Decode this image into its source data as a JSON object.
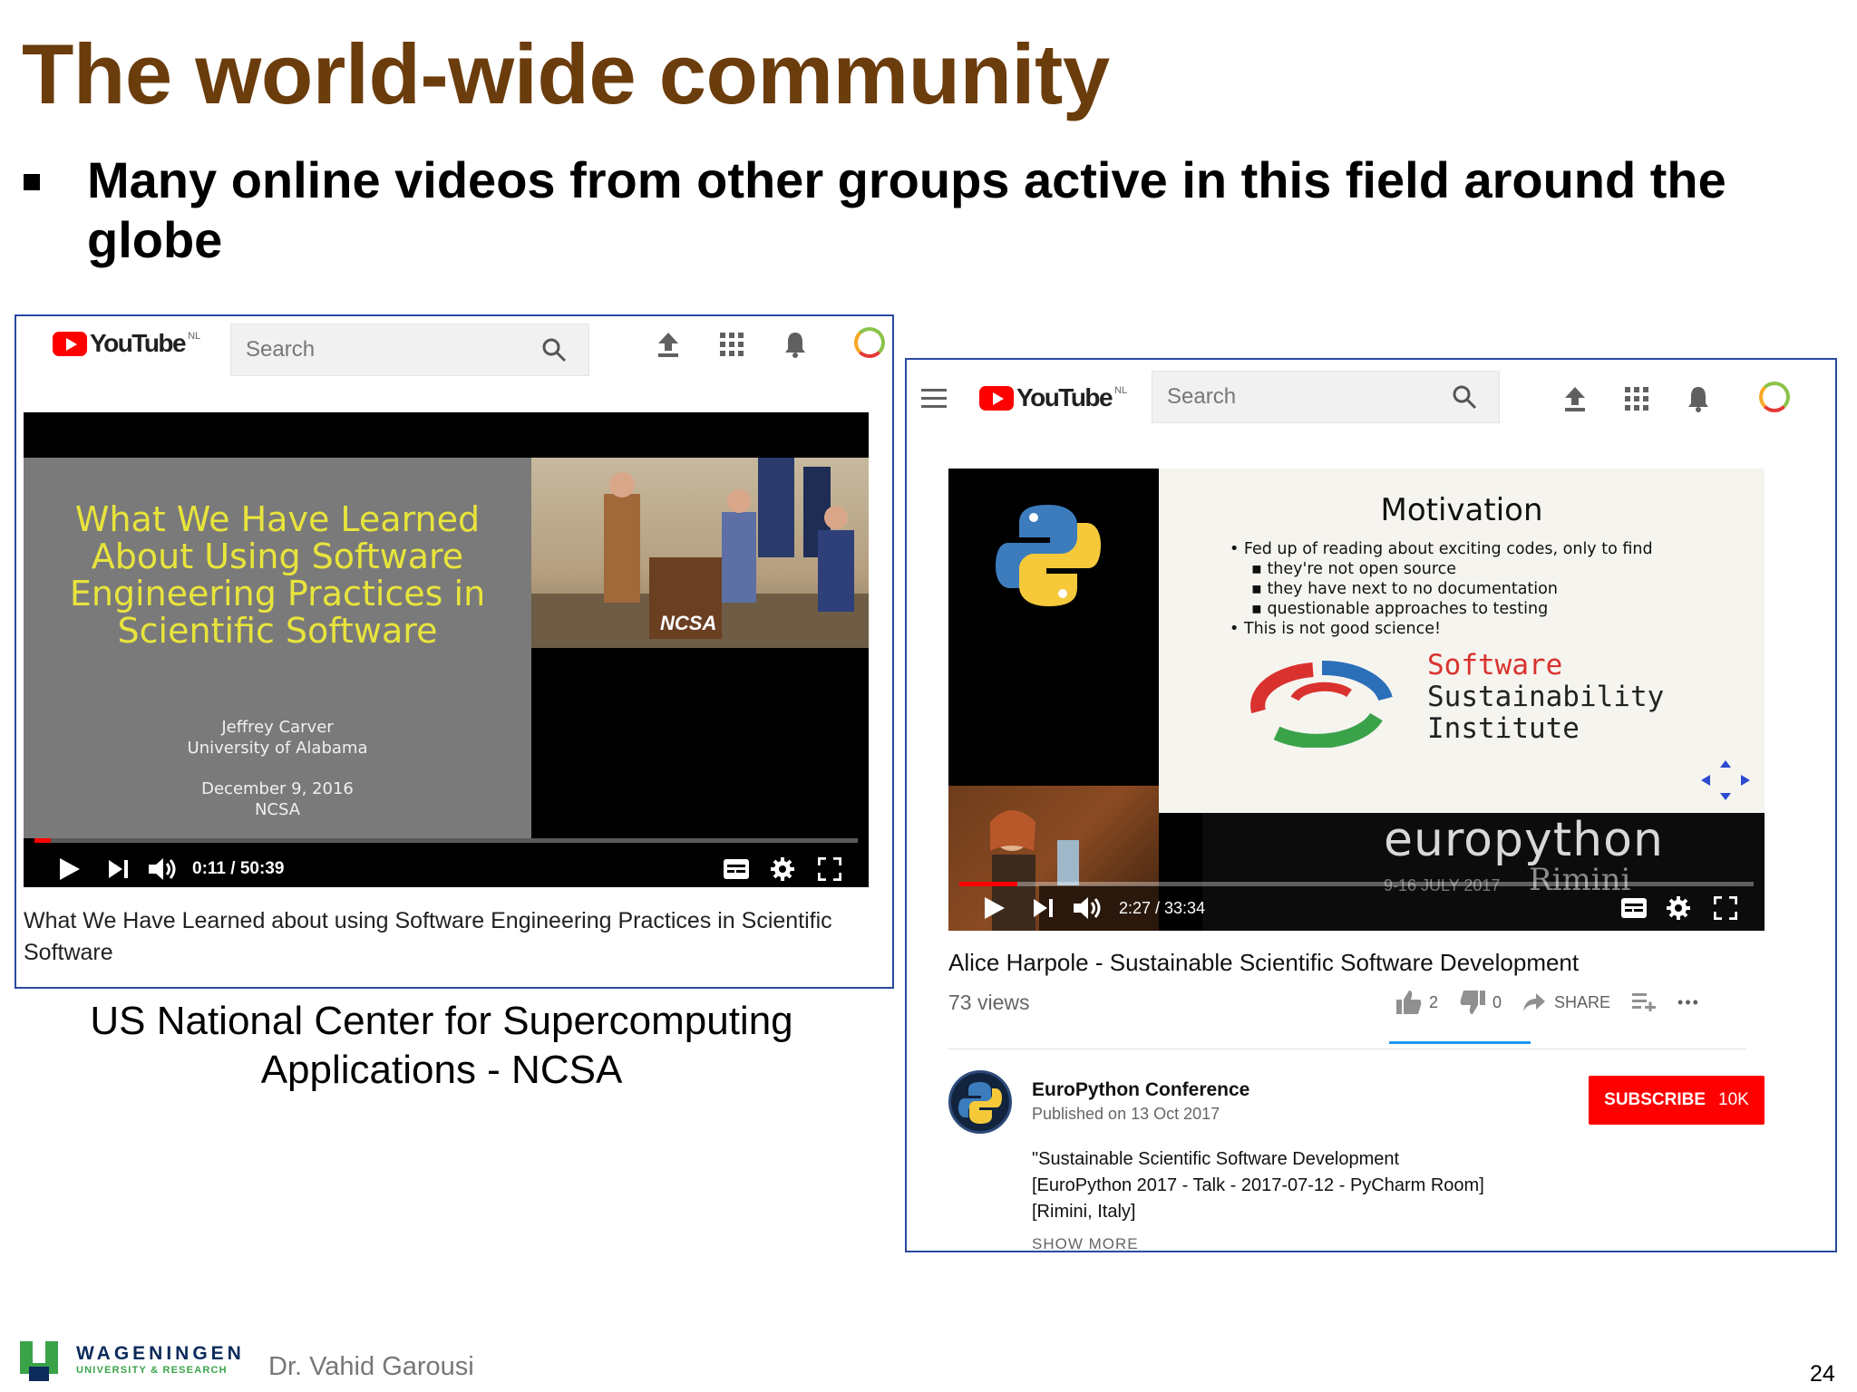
{
  "slide": {
    "title": "The world-wide community",
    "bullet": "Many online videos from other groups active in this field around the globe",
    "footer": {
      "org_name": "WAGENINGEN",
      "org_sub": "UNIVERSITY & RESEARCH",
      "presenter": "Dr. Vahid Garousi",
      "page_number": "24"
    }
  },
  "left_panel": {
    "youtube": {
      "logo": "YouTube",
      "region": "NL",
      "search_placeholder": "Search"
    },
    "video": {
      "slide_title": "What We Have Learned About Using Software Engineering Practices in Scientific Software",
      "author": "Jeffrey Carver",
      "affiliation": "University of Alabama",
      "date": "December 9, 2016",
      "venue": "NCSA",
      "podium_text": "NCSA",
      "time": "0:11 / 50:39",
      "progress": 0.004
    },
    "video_title": "What We Have Learned about using Software Engineering Practices in Scientific Software",
    "caption": "US National Center for Supercomputing Applications - NCSA"
  },
  "right_panel": {
    "youtube": {
      "logo": "YouTube",
      "region": "NL",
      "search_placeholder": "Search"
    },
    "video": {
      "slide_heading": "Motivation",
      "bullets": [
        "Fed up of reading about exciting codes, only to find",
        "they're not open source",
        "they have next to no documentation",
        "questionable approaches to testing",
        "This is not good science!"
      ],
      "ssi_line1": "Software",
      "ssi_line2": "Sustainability",
      "ssi_line3": "Institute",
      "banner": "europython",
      "banner_date": "9-16 JULY 2017",
      "banner_city": "Rimini",
      "time": "2:27 / 33:34",
      "progress": 0.073
    },
    "video_title": "Alice Harpole - Sustainable Scientific Software Development",
    "views": "73 views",
    "likes": "2",
    "dislikes": "0",
    "share_label": "SHARE",
    "more_label": "•••",
    "channel": "EuroPython Conference",
    "published": "Published on 13 Oct 2017",
    "subscribe_label": "SUBSCRIBE",
    "subscriber_count": "10K",
    "description": [
      "\"Sustainable Scientific Software Development",
      "[EuroPython 2017 - Talk - 2017-07-12 - PyCharm Room]",
      "[Rimini, Italy]"
    ],
    "show_more": "SHOW MORE"
  },
  "colors": {
    "title": "#6b3c0c",
    "panel_border": "#2a4aa0",
    "youtube_red": "#ff0000",
    "slide_yellow": "#e8e43c",
    "like_bar": "#2196f3"
  }
}
